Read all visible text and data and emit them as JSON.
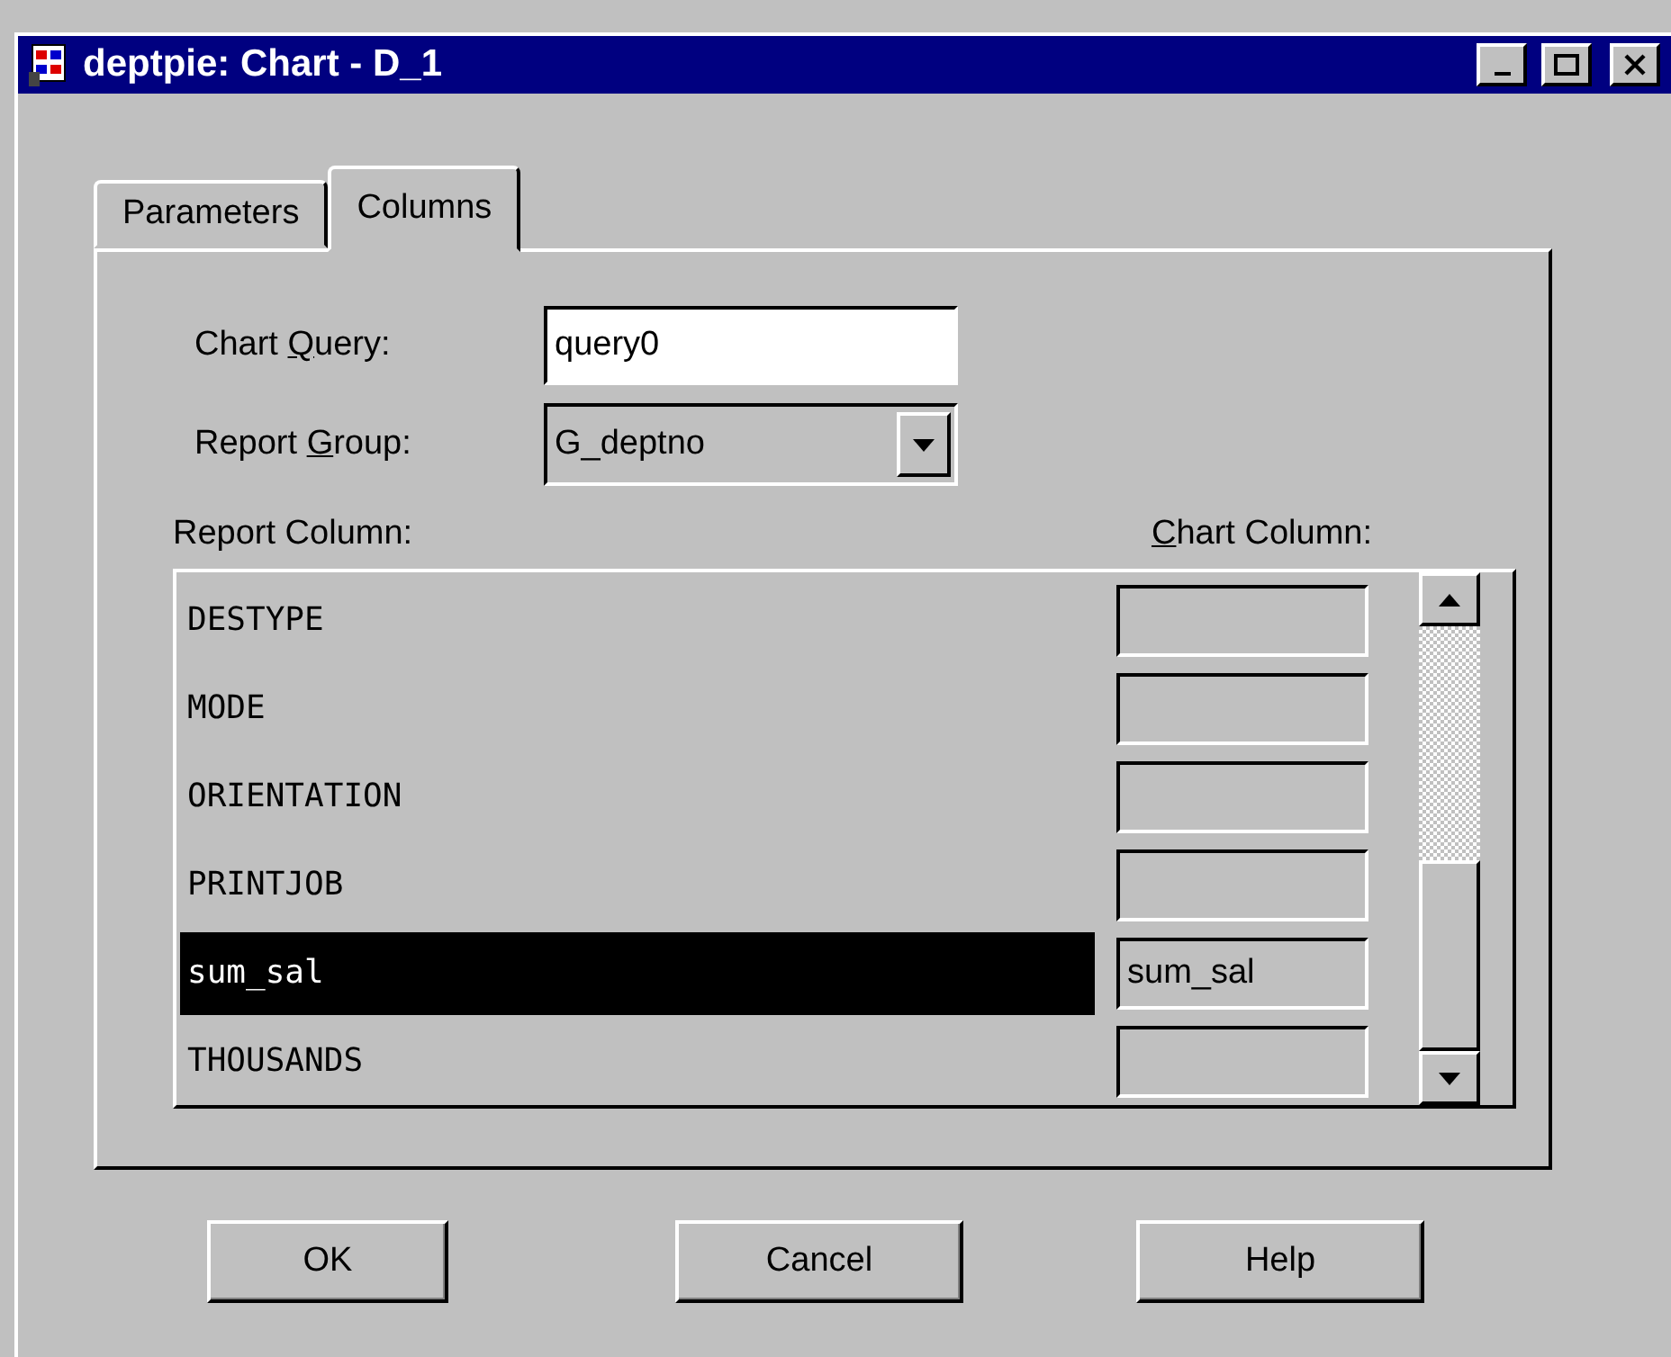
{
  "window": {
    "title": "deptpie: Chart - D_1"
  },
  "tabs": [
    {
      "label": "Parameters",
      "selected": false
    },
    {
      "label": "Columns",
      "selected": true
    }
  ],
  "chart_query": {
    "label": {
      "pre": "Chart ",
      "key": "Q",
      "post": "uery:"
    },
    "value": "query0"
  },
  "report_group": {
    "label": {
      "pre": "Report ",
      "key": "G",
      "post": "roup:"
    },
    "value": "G_deptno"
  },
  "report_column_header": "Report Column:",
  "chart_column_header": {
    "key": "C",
    "post": "hart Column:"
  },
  "rows": [
    {
      "report_column": "DESTYPE",
      "chart_column": "",
      "selected": false
    },
    {
      "report_column": "MODE",
      "chart_column": "",
      "selected": false
    },
    {
      "report_column": "ORIENTATION",
      "chart_column": "",
      "selected": false
    },
    {
      "report_column": "PRINTJOB",
      "chart_column": "",
      "selected": false
    },
    {
      "report_column": "sum_sal",
      "chart_column": "sum_sal",
      "selected": true
    },
    {
      "report_column": "THOUSANDS",
      "chart_column": "",
      "selected": false
    }
  ],
  "buttons": [
    "OK",
    "Cancel",
    "Help"
  ]
}
